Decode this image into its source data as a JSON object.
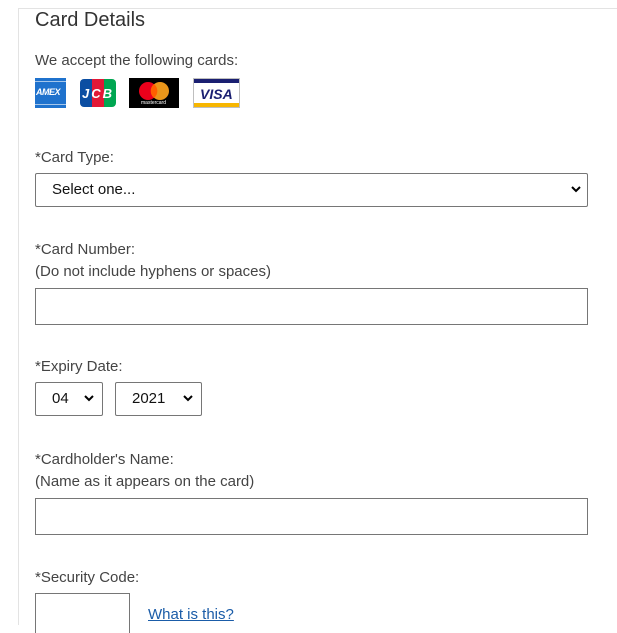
{
  "form": {
    "title": "Card Details",
    "accept_text": "We accept the following cards:",
    "logos": [
      {
        "label": "AMEX",
        "color": "#1f72cd"
      },
      {
        "label": "JCB",
        "color": "#0b4ea2"
      },
      {
        "label": "mastercard",
        "color": "#000000"
      },
      {
        "label": "VISA",
        "color": "#1a1f71"
      }
    ],
    "card_type": {
      "label": "*Card Type:",
      "value": "Select one..."
    },
    "card_number": {
      "label": "*Card Number:",
      "hint": "(Do not include hyphens or spaces)",
      "value": ""
    },
    "expiry": {
      "label": "*Expiry Date:",
      "month": "04",
      "year": "2021"
    },
    "cardholder": {
      "label": "*Cardholder's Name:",
      "hint": "(Name as it appears on the card)",
      "value": ""
    },
    "security_code": {
      "label": "*Security Code:",
      "value": "",
      "help_link": "What is this?"
    }
  },
  "colors": {
    "link": "#1a5ca8",
    "border": "#767676",
    "mastercard_red": "#eb001b",
    "mastercard_orange": "#f79e1b"
  }
}
